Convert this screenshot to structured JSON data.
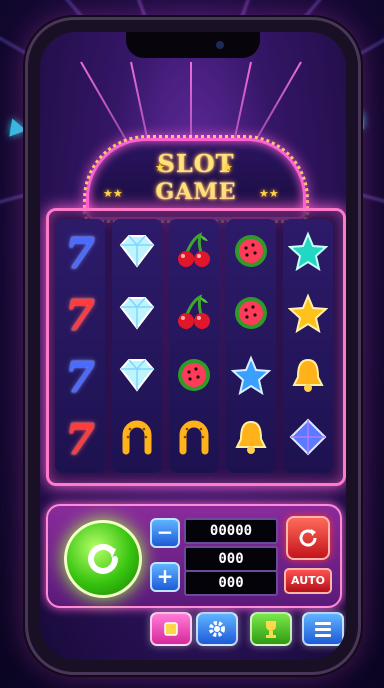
{
  "game": {
    "title_line1": "SLOT",
    "title_line2": "GAME"
  },
  "reels": [
    [
      "seven-blue",
      "seven-red",
      "seven-blue",
      "seven-red"
    ],
    [
      "diamond",
      "diamond",
      "diamond",
      "horseshoe"
    ],
    [
      "cherries",
      "cherries",
      "watermelon",
      "horseshoe"
    ],
    [
      "watermelon",
      "watermelon",
      "star-blue",
      "bell"
    ],
    [
      "star-cyan",
      "star-gold",
      "bell",
      "gem-blue"
    ]
  ],
  "symbols": {
    "seven-blue": {
      "glyph": "7",
      "color": "#4a6bff"
    },
    "seven-red": {
      "glyph": "7",
      "color": "#ff3b3b"
    }
  },
  "displays": {
    "top": "00000",
    "middle": "000",
    "bottom": "000"
  },
  "controls": {
    "minus_label": "−",
    "plus_label": "+",
    "auto_label": "AUTO"
  },
  "colors": {
    "neon_pink": "#ff5fd2",
    "spin_green": "#37c40f",
    "gold": "#ffe27a"
  }
}
